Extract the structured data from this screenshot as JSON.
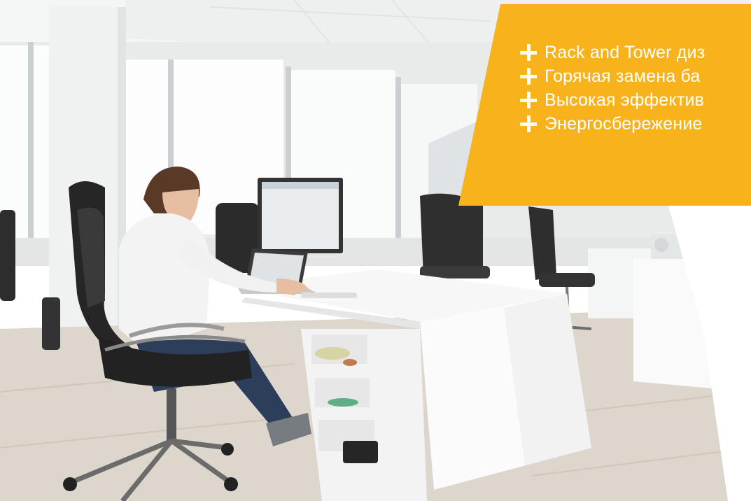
{
  "scene": {
    "photo_subject": "office-workspace",
    "colors": {
      "banner": "#F8B31C",
      "banner_text": "#FFFFFF",
      "wall": "#F1F2F2",
      "desk": "#FBFBFB",
      "floor": "#D9D2C8",
      "chair_mesh": "#2A2A2A",
      "shirt": "#F3F3F3",
      "jeans": "#2D3E5A",
      "hair": "#5A3A26"
    }
  },
  "banner": {
    "features": [
      {
        "icon": "plus-icon",
        "label": "Rack and Tower диз"
      },
      {
        "icon": "plus-icon",
        "label": "Горячая замена ба"
      },
      {
        "icon": "plus-icon",
        "label": "Высокая эффектив"
      },
      {
        "icon": "plus-icon",
        "label": "Энергосбережение"
      }
    ]
  }
}
